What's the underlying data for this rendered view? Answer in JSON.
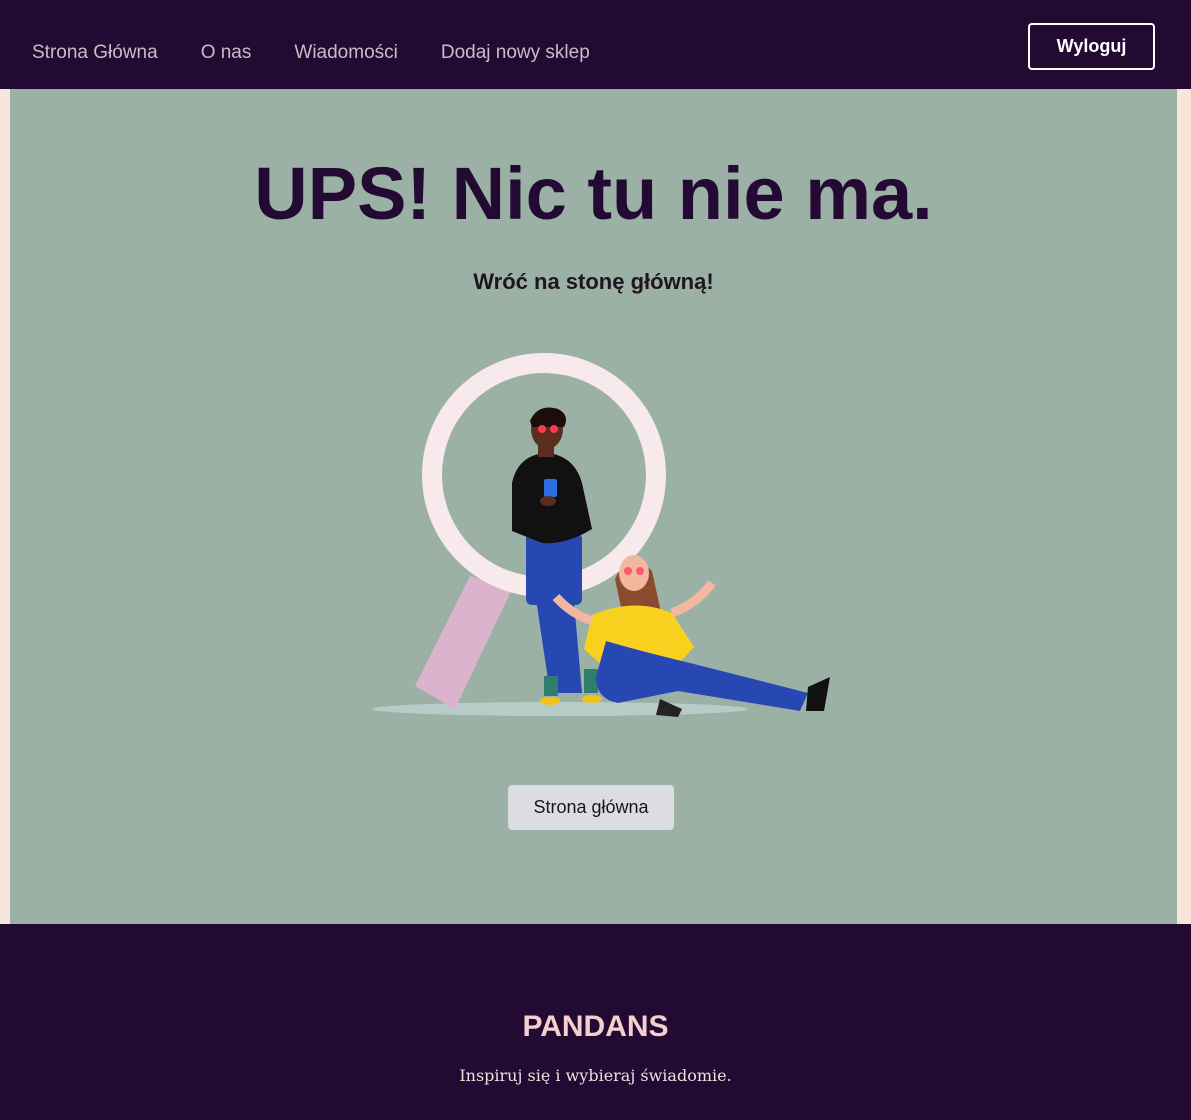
{
  "nav": {
    "links": [
      {
        "label": "Strona Główna"
      },
      {
        "label": "O nas"
      },
      {
        "label": "Wiadomości"
      },
      {
        "label": "Dodaj nowy sklep"
      }
    ],
    "logout_label": "Wyloguj"
  },
  "main": {
    "title": "UPS! Nic tu nie ma.",
    "subtitle": "Wróć na stonę główną!",
    "illustration_icon": "magnifier-people-illustration",
    "home_button_label": "Strona główna"
  },
  "footer": {
    "brand": "PANDANS",
    "tagline": "Inspiruj się i wybieraj świadomie."
  },
  "colors": {
    "nav_bg": "#230a33",
    "main_bg": "#9cb1a5",
    "page_bg": "#f7e6da",
    "brand": "#f5cfd0"
  }
}
